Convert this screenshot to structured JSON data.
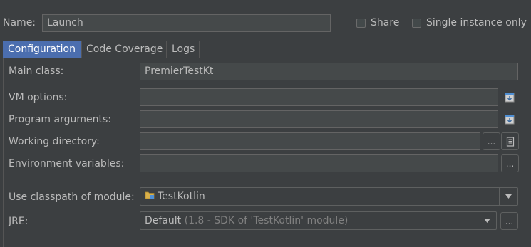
{
  "header": {
    "name_label": "Name:",
    "name_value": "Launch",
    "share_label": "Share",
    "share_checked": false,
    "single_instance_label": "Single instance only",
    "single_instance_checked": false
  },
  "tabs": [
    {
      "label": "Configuration",
      "active": true
    },
    {
      "label": "Code Coverage",
      "active": false
    },
    {
      "label": "Logs",
      "active": false
    }
  ],
  "config": {
    "main_class_label": "Main class:",
    "main_class_value": "PremierTestKt",
    "vm_options_label": "VM options:",
    "vm_options_value": "",
    "program_arguments_label": "Program arguments:",
    "program_arguments_value": "",
    "working_directory_label": "Working directory:",
    "working_directory_value": "",
    "env_variables_label": "Environment variables:",
    "env_variables_value": "",
    "classpath_label": "Use classpath of module:",
    "classpath_value": "TestKotlin",
    "jre_label": "JRE:",
    "jre_value": "Default",
    "jre_detail": "(1.8 - SDK of 'TestKotlin' module)",
    "browse_label": "...",
    "expand_icon": "expand-field-icon",
    "macro_icon": "document-icon"
  }
}
